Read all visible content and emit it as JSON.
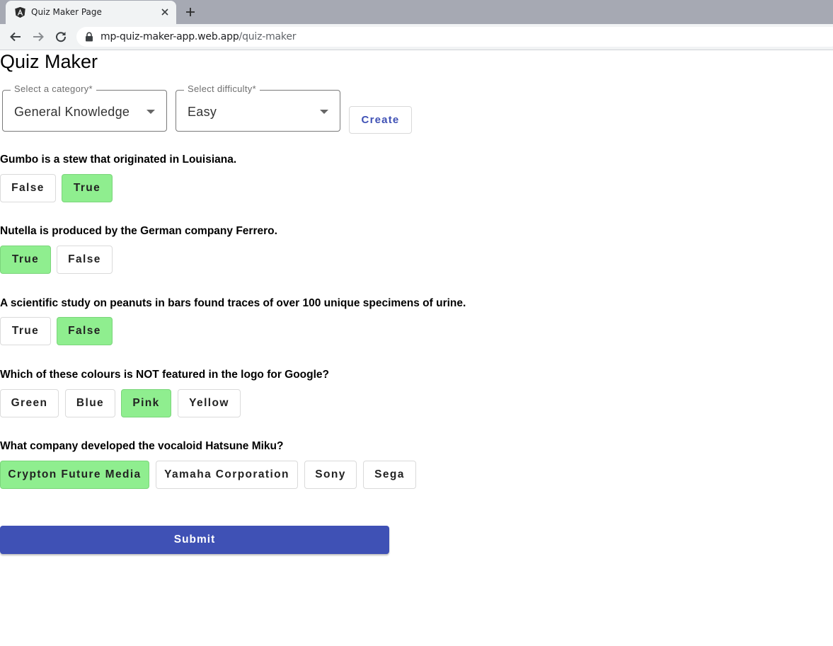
{
  "browser": {
    "tab_title": "Quiz Maker Page",
    "url_host": "mp-quiz-maker-app.web.app",
    "url_path": "/quiz-maker"
  },
  "page": {
    "title": "Quiz Maker",
    "category": {
      "label": "Select a category*",
      "value": "General Knowledge"
    },
    "difficulty": {
      "label": "Select difficulty*",
      "value": "Easy"
    },
    "create_label": "Create",
    "submit_label": "Submit"
  },
  "colors": {
    "accent": "#3f51b5",
    "selected_answer": "#8fee8f"
  },
  "questions": [
    {
      "text": "Gumbo is a stew that originated in Louisiana.",
      "answers": [
        {
          "label": "False",
          "selected": false
        },
        {
          "label": "True",
          "selected": true
        }
      ]
    },
    {
      "text": "Nutella is produced by the German company Ferrero.",
      "answers": [
        {
          "label": "True",
          "selected": true
        },
        {
          "label": "False",
          "selected": false
        }
      ]
    },
    {
      "text": "A scientific study on peanuts in bars found traces of over 100 unique specimens of urine.",
      "answers": [
        {
          "label": "True",
          "selected": false
        },
        {
          "label": "False",
          "selected": true
        }
      ]
    },
    {
      "text": "Which of these colours is NOT featured in the logo for Google?",
      "answers": [
        {
          "label": "Green",
          "selected": false
        },
        {
          "label": "Blue",
          "selected": false
        },
        {
          "label": "Pink",
          "selected": true
        },
        {
          "label": "Yellow",
          "selected": false
        }
      ]
    },
    {
      "text": "What company developed the vocaloid Hatsune Miku?",
      "answers": [
        {
          "label": "Crypton Future Media",
          "selected": true
        },
        {
          "label": "Yamaha Corporation",
          "selected": false
        },
        {
          "label": "Sony",
          "selected": false
        },
        {
          "label": "Sega",
          "selected": false
        }
      ]
    }
  ]
}
